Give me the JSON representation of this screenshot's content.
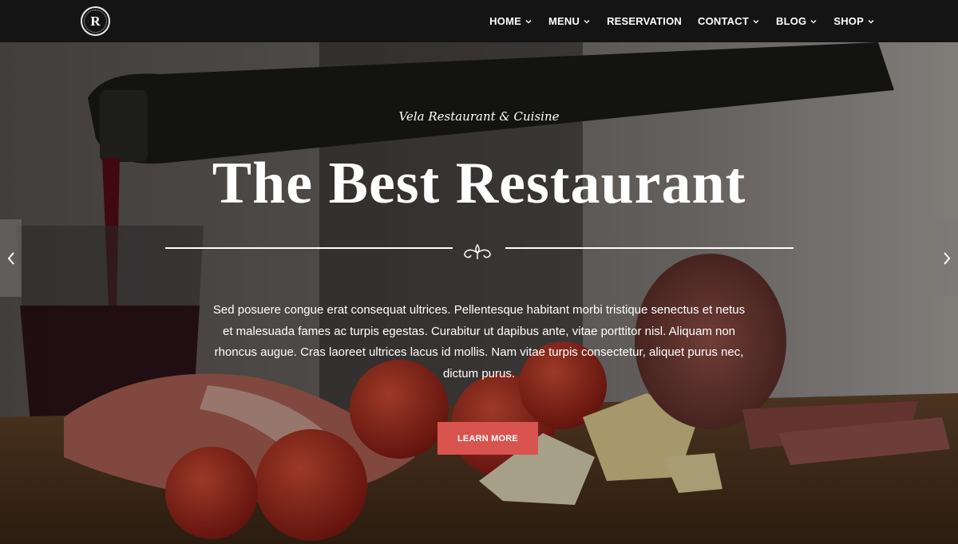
{
  "brand": {
    "logo_letter": "R",
    "logo_icon": "circle-monogram-logo"
  },
  "nav": {
    "items": [
      {
        "label": "HOME",
        "has_dropdown": true
      },
      {
        "label": "MENU",
        "has_dropdown": true
      },
      {
        "label": "RESERVATION",
        "has_dropdown": false
      },
      {
        "label": "CONTACT",
        "has_dropdown": true
      },
      {
        "label": "BLOG",
        "has_dropdown": true
      },
      {
        "label": "SHOP",
        "has_dropdown": true
      }
    ]
  },
  "hero": {
    "tagline": "Vela Restaurant & Cuisine",
    "headline": "The Best Restaurant",
    "ornament_icon": "flourish-ornament-icon",
    "description": "Sed posuere congue erat consequat ultrices. Pellentesque habitant morbi tristique senectus et netus et malesuada fames ac turpis egestas. Curabitur ut dapibus ante, vitae porttitor nisl. Aliquam non rhoncus augue. Cras laoreet ultrices lacus id mollis. Nam vitae turpis consectetur, aliquet purus nec, dictum purus.",
    "cta_label": "LEARN MORE",
    "prev_icon": "chevron-left-icon",
    "next_icon": "chevron-right-icon"
  },
  "colors": {
    "header_bg": "#141414",
    "accent": "#d9534f",
    "text": "#ffffff"
  }
}
